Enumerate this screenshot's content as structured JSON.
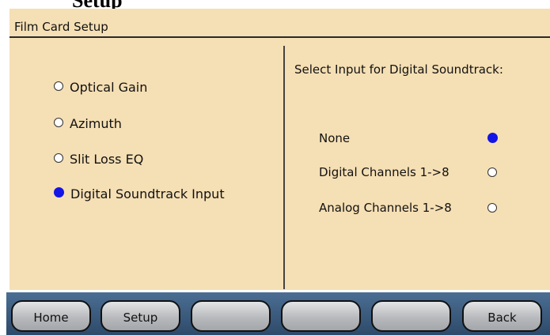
{
  "page_heading": "Setup",
  "window": {
    "title": "Film Card Setup"
  },
  "menu": {
    "items": [
      {
        "label": "Optical Gain",
        "selected": false
      },
      {
        "label": "Azimuth",
        "selected": false
      },
      {
        "label": "Slit Loss EQ",
        "selected": false
      },
      {
        "label": "Digital Soundtrack Input",
        "selected": true
      }
    ]
  },
  "input_select": {
    "heading": "Select Input for Digital Soundtrack:",
    "options": [
      {
        "label": "None",
        "selected": true
      },
      {
        "label": "Digital Channels 1->8",
        "selected": false
      },
      {
        "label": "Analog Channels 1->8",
        "selected": false
      }
    ]
  },
  "buttons": [
    {
      "label": "Home"
    },
    {
      "label": "Setup"
    },
    {
      "label": ""
    },
    {
      "label": ""
    },
    {
      "label": ""
    },
    {
      "label": "Back"
    }
  ],
  "colors": {
    "panel_background": "#f5dfb4",
    "selected_radio": "#1414e6",
    "button_bar": "#3a5a7e"
  }
}
